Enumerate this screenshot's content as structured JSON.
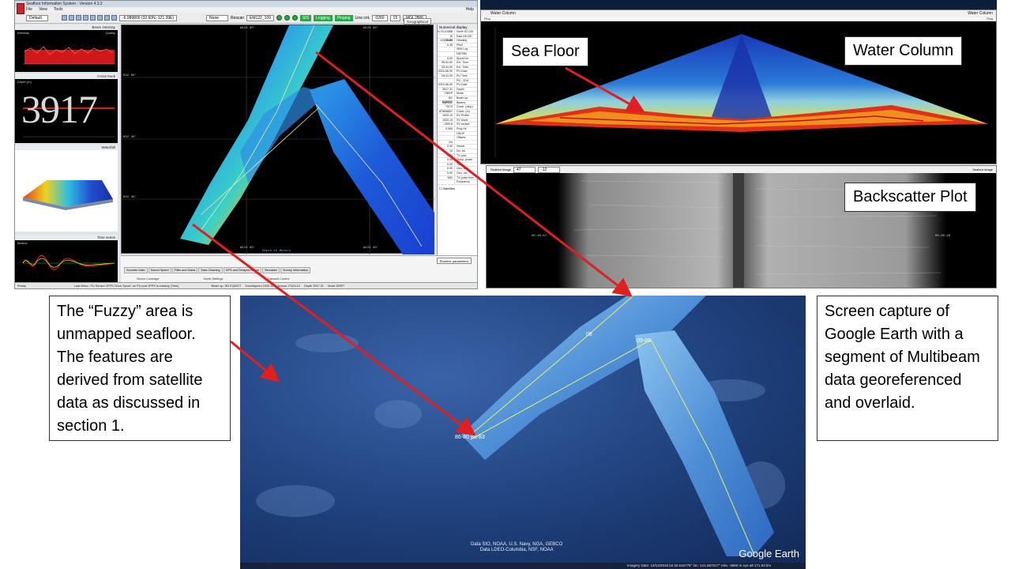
{
  "sis": {
    "title": "Seafloor Information System - Version 4.3.2",
    "menu": [
      "File",
      "View",
      "Tools"
    ],
    "help": "Help",
    "profile_select": "Default",
    "toolbar": {
      "none_select": "None",
      "rescan_label": "Rescan",
      "file_select": "EM122_109",
      "status_chips": [
        "SIS",
        "Logging",
        "Pinging"
      ],
      "line_cnt_label": "Line cnt.",
      "line_cnt_value": "0260",
      "line_cnt_value2": "15",
      "survey_select": "MGL2806",
      "coord_value": "-5.989800 (32.60N,-121.39E)"
    },
    "panels": {
      "beam_intensity": "Beam intensity",
      "intensity": "Intensity",
      "quality": "Quality",
      "cross_track": "Cross track",
      "depth_label": "Depth (m)",
      "depth_value": "3917",
      "waterfall": "Waterfall",
      "time_series": "Time series",
      "beams": "Beams"
    },
    "geo": {
      "display_select": "Geographical",
      "lat_labels": [
        "N32 60'",
        "N32 40'",
        "N32 40'"
      ],
      "lon_labels": [
        "W121 60'",
        "W121 40'",
        "W121 60'",
        "W121 40'"
      ],
      "footer": "Depth in Meters"
    },
    "numerical": {
      "title": "Numerical display",
      "rows": [
        [
          "N 33.1038B",
          "North DD.DD"
        ],
        [
          "W 121.3642I",
          "East DD.DD"
        ],
        [
          "230.60",
          "Heading"
        ],
        [
          "-0.38",
          "Pitch"
        ],
        [
          "",
          "SBH Log"
        ],
        [
          "",
          "NB7080"
        ],
        [
          "5.00",
          "Speed kn"
        ],
        [
          "05:41:00",
          "Ext. Time"
        ],
        [
          "05:41:00",
          "Ext. Time"
        ],
        [
          "2015-06-30",
          "PU Date"
        ],
        [
          "05:41:00",
          "PU Time"
        ],
        [
          "",
          "PU - ZDA"
        ],
        [
          "2015-06-30",
          "PU Date"
        ],
        [
          "3917.31",
          "Depth"
        ],
        [
          "DEEP",
          "Mode"
        ],
        [
          "HD EQDIST",
          "Beam sp."
        ],
        [
          "432/432",
          "Beams"
        ],
        [
          "70/70",
          "Cover. (deg.)"
        ],
        [
          "8788/8657",
          "Cover. (m)"
        ],
        [
          "1533.10",
          "SV Profile"
        ],
        [
          "1533.10",
          "SV Used"
        ],
        [
          "1509.6",
          "SV sensor"
        ],
        [
          "0.060",
          "Ping Hz"
        ],
        [
          "",
          "HDOP"
        ],
        [
          "",
          "Offsets"
        ],
        [
          "On",
          ""
        ],
        [
          "0.00",
          "Heave"
        ],
        [
          "10",
          "No. sw."
        ],
        [
          "0.00",
          "TX pow."
        ],
        [
          "0.00",
          "Temp. probe"
        ],
        [
          "0.00",
          "Tide"
        ],
        [
          "0.00",
          "Geo. und."
        ],
        [
          "0.00",
          "Geo. vel."
        ],
        [
          "MIX",
          "TX pulse form"
        ],
        [
          "",
          "Frequency"
        ]
      ],
      "satellites": "Satellites"
    },
    "tabs": [
      "Sounder Main",
      "Sound Speed",
      "Filter and Gains",
      "Data Cleaning",
      "GPS and Delayed Heave",
      "Simulator",
      "Survey Information"
    ],
    "runtime_select": "Runtime parameters",
    "sub_headers": [
      "Sector Coverage",
      "Depth Settings",
      "Transmit Control"
    ],
    "status": {
      "ready": "Ready",
      "text": "Last Mess.: PU Sensor 1PPS Clock Synch. on PU port 1PPS is missing (Time)",
      "fields": [
        [
          "Beam sp.",
          "HD EQDIST"
        ],
        [
          "Soundspeed",
          "1533.10"
        ],
        [
          "Across",
          "17424.12"
        ],
        [
          "Depth",
          "3917.31"
        ],
        [
          "Mode",
          "DEEP"
        ]
      ]
    }
  },
  "water_column": {
    "title": "Water Column",
    "display_label": "Water Column",
    "ping_label": "Ping",
    "right_label": "Ping"
  },
  "seabed": {
    "title": "Seabed Image",
    "display_label": "Seabed image",
    "time_left": "05:40:57",
    "time_right": "05:40:28",
    "tool_values": [
      "47",
      "-12"
    ]
  },
  "google_earth": {
    "logo": "Google Earth",
    "credit_line1": "Data SIO, NOAA, U.S. Navy, NGA, GEBCO",
    "credit_line2": "Data LDEO-Columbia, NSF, NOAA",
    "status_line": "Imagery Date: 12/13/2015    lat 32.516775°  lon -121.667017°  elev -3660 m    eye alt 171.63 km",
    "line_labels": [
      "86-80 86-83",
      "08",
      "09-89"
    ]
  },
  "callouts": {
    "sea_floor": "Sea Floor",
    "water_column": "Water Column",
    "backscatter": "Backscatter Plot",
    "fuzzy": "The “Fuzzy” area is unmapped seafloor. The features are derived from satellite data as discussed in section 1.",
    "screen_capture": "Screen capture of Google Earth with a segment of Multibeam data georeferenced and overlaid."
  },
  "colors": {
    "arrow": "#e02020",
    "bathy_low": "#1a3fd0",
    "bathy_high": "#e84d1a",
    "ge_ocean": "#1e3f7a"
  }
}
